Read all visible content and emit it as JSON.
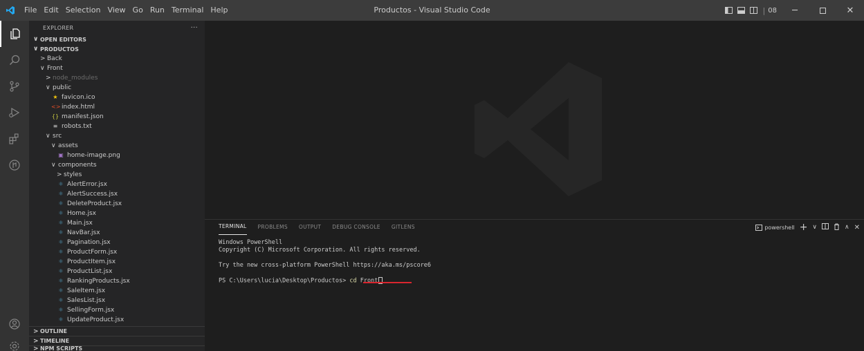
{
  "titlebar": {
    "menu": [
      "File",
      "Edit",
      "Selection",
      "View",
      "Go",
      "Run",
      "Terminal",
      "Help"
    ],
    "window_title": "Productos - Visual Studio Code",
    "grid_count": "08"
  },
  "sidebar": {
    "header": "EXPLORER",
    "more": "···",
    "open_editors": "OPEN EDITORS",
    "project": "PRODUCTOS",
    "tree": [
      {
        "label": "Back",
        "indent": 1,
        "chev": ">",
        "icon": "",
        "dim": false
      },
      {
        "label": "Front",
        "indent": 1,
        "chev": "∨",
        "icon": "",
        "dim": false
      },
      {
        "label": "node_modules",
        "indent": 2,
        "chev": ">",
        "icon": "",
        "dim": true
      },
      {
        "label": "public",
        "indent": 2,
        "chev": "∨",
        "icon": "",
        "dim": false
      },
      {
        "label": "favicon.ico",
        "indent": 3,
        "chev": "",
        "icon": "star",
        "dim": false
      },
      {
        "label": "index.html",
        "indent": 3,
        "chev": "",
        "icon": "html",
        "dim": false
      },
      {
        "label": "manifest.json",
        "indent": 3,
        "chev": "",
        "icon": "json",
        "dim": false
      },
      {
        "label": "robots.txt",
        "indent": 3,
        "chev": "",
        "icon": "txt",
        "dim": false
      },
      {
        "label": "src",
        "indent": 2,
        "chev": "∨",
        "icon": "",
        "dim": false
      },
      {
        "label": "assets",
        "indent": 3,
        "chev": "∨",
        "icon": "",
        "dim": false
      },
      {
        "label": "home-image.png",
        "indent": 4,
        "chev": "",
        "icon": "image",
        "dim": false
      },
      {
        "label": "components",
        "indent": 3,
        "chev": "∨",
        "icon": "",
        "dim": false
      },
      {
        "label": "styles",
        "indent": 4,
        "chev": ">",
        "icon": "",
        "dim": false
      },
      {
        "label": "AlertError.jsx",
        "indent": 4,
        "chev": "",
        "icon": "react",
        "dim": false
      },
      {
        "label": "AlertSuccess.jsx",
        "indent": 4,
        "chev": "",
        "icon": "react",
        "dim": false
      },
      {
        "label": "DeleteProduct.jsx",
        "indent": 4,
        "chev": "",
        "icon": "react",
        "dim": false
      },
      {
        "label": "Home.jsx",
        "indent": 4,
        "chev": "",
        "icon": "react",
        "dim": false
      },
      {
        "label": "Main.jsx",
        "indent": 4,
        "chev": "",
        "icon": "react",
        "dim": false
      },
      {
        "label": "NavBar.jsx",
        "indent": 4,
        "chev": "",
        "icon": "react",
        "dim": false
      },
      {
        "label": "Pagination.jsx",
        "indent": 4,
        "chev": "",
        "icon": "react",
        "dim": false
      },
      {
        "label": "ProductForm.jsx",
        "indent": 4,
        "chev": "",
        "icon": "react",
        "dim": false
      },
      {
        "label": "ProductItem.jsx",
        "indent": 4,
        "chev": "",
        "icon": "react",
        "dim": false
      },
      {
        "label": "ProductList.jsx",
        "indent": 4,
        "chev": "",
        "icon": "react",
        "dim": false
      },
      {
        "label": "RankingProducts.jsx",
        "indent": 4,
        "chev": "",
        "icon": "react",
        "dim": false
      },
      {
        "label": "SaleItem.jsx",
        "indent": 4,
        "chev": "",
        "icon": "react",
        "dim": false
      },
      {
        "label": "SalesList.jsx",
        "indent": 4,
        "chev": "",
        "icon": "react",
        "dim": false
      },
      {
        "label": "SellingForm.jsx",
        "indent": 4,
        "chev": "",
        "icon": "react",
        "dim": false
      },
      {
        "label": "UpdateProduct.jsx",
        "indent": 4,
        "chev": "",
        "icon": "react",
        "dim": false
      }
    ],
    "outline": "OUTLINE",
    "timeline": "TIMELINE",
    "npm_scripts": "NPM SCRIPTS"
  },
  "panel": {
    "tabs": [
      "TERMINAL",
      "PROBLEMS",
      "OUTPUT",
      "DEBUG CONSOLE",
      "GITLENS"
    ],
    "shell": "powershell",
    "terminal": {
      "line1": "Windows PowerShell",
      "line2": "Copyright (C) Microsoft Corporation. All rights reserved.",
      "line3": "Try the new cross-platform PowerShell https://aka.ms/pscore6",
      "prompt": "PS C:\\Users\\lucia\\Desktop\\Productos> ",
      "command": "cd",
      "argument": " Front"
    }
  },
  "colors": {
    "accent_blue": "#519aba",
    "react_icon": "#519aba",
    "annotation_red": "#d9262e",
    "star_icon": "#f1c40f",
    "json_icon": "#cbcb41",
    "html_icon": "#e44d26"
  }
}
